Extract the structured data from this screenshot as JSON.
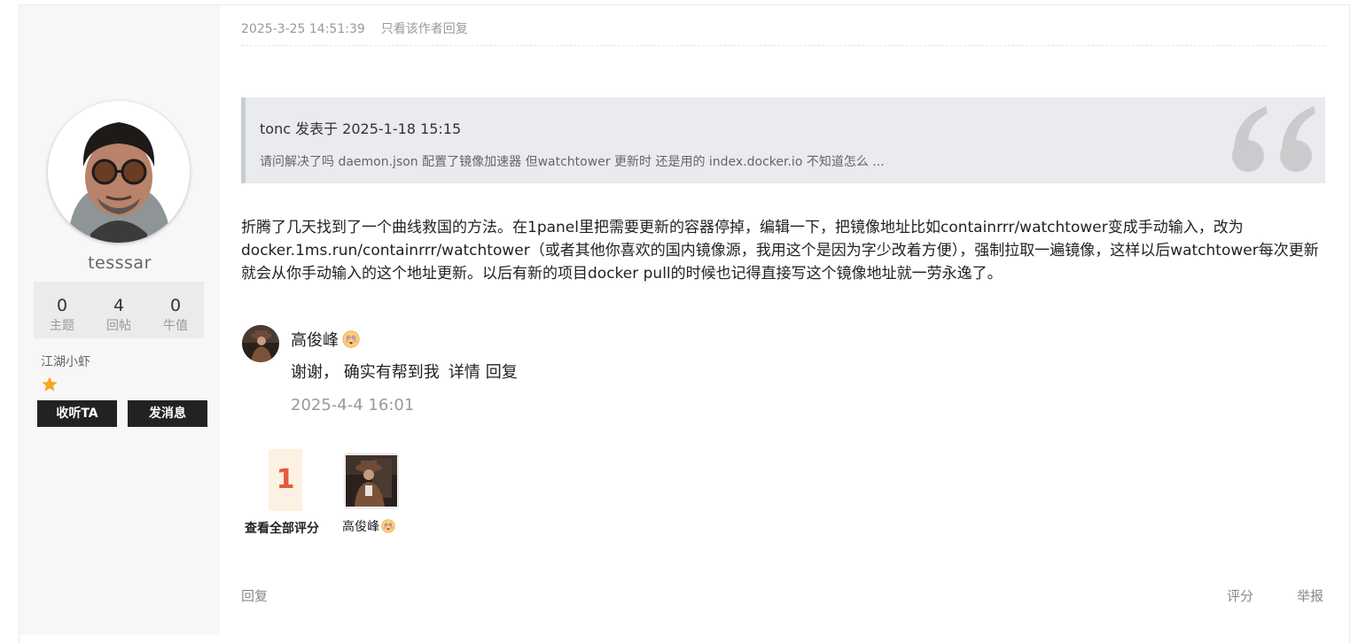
{
  "author": {
    "username": "tesssar",
    "stats": [
      {
        "value": "0",
        "label": "主题"
      },
      {
        "value": "4",
        "label": "回帖"
      },
      {
        "value": "0",
        "label": "牛值"
      }
    ],
    "rank": "江湖小虾",
    "stars": 1,
    "follow_label": "收听TA",
    "message_label": "发消息"
  },
  "post": {
    "time": "2025-3-25 14:51:39",
    "author_only_label": "只看该作者",
    "reply_label": "回复",
    "quote": {
      "header": "tonc 发表于 2025-1-18 15:15",
      "body": "请问解决了吗  daemon.json 配置了镜像加速器  但watchtower 更新时 还是用的 index.docker.io  不知道怎么 ..."
    },
    "content": "折腾了几天找到了一个曲线救国的方法。在1panel里把需要更新的容器停掉，编辑一下，把镜像地址比如containrrr/watchtower变成手动输入，改为docker.1ms.run/containrrr/watchtower（或者其他你喜欢的国内镜像源，我用这个是因为字少改着方便），强制拉取一遍镜像，这样以后watchtower每次更新就会从你手动输入的这个地址更新。以后有新的项目docker pull的时候也记得直接写这个镜像地址就一劳永逸了。"
  },
  "comment": {
    "user": "高俊峰",
    "text": "谢谢， 确实有帮到我",
    "detail_label": "详情",
    "reply_label": "回复",
    "date": "2025-4-4 16:01"
  },
  "rating": {
    "count": "1",
    "view_all_label": "查看全部评分",
    "rater_name": "高俊峰"
  },
  "footer": {
    "reply_label": "回复",
    "rate_label": "评分",
    "report_label": "举报"
  },
  "icons": {
    "star": "star-icon",
    "emoji": "flushed-face-emoji",
    "quote": "quotation-mark-icon"
  },
  "colors": {
    "star": "#f5a623",
    "rating_count": "#e8593f",
    "rating_bg": "#fdf2e2",
    "button_dark": "#222222"
  }
}
